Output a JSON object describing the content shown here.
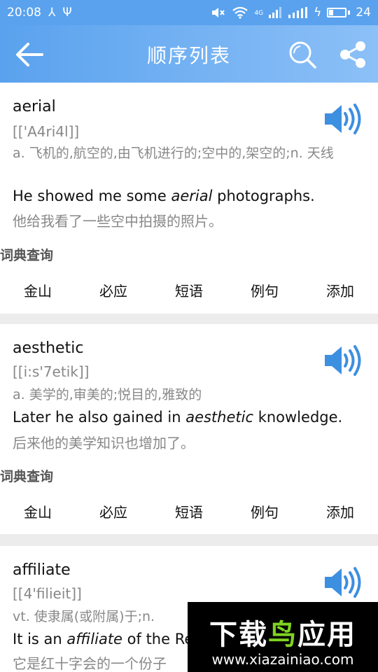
{
  "status": {
    "time": "20:08",
    "network_badge": "4G",
    "battery_level": "24",
    "battery_fraction": 0.24
  },
  "header": {
    "title": "顺序列表"
  },
  "dict_section_label": "词典查询",
  "dict_buttons": [
    "金山",
    "必应",
    "短语",
    "例句",
    "添加"
  ],
  "entries": [
    {
      "word": "aerial",
      "phonetic": "[['A4ri4l]]",
      "definition": "a. 飞机的,航空的,由飞机进行的;空中的,架空的;n. 天线",
      "example_before": "He showed me some ",
      "example_word": "aerial",
      "example_after": " photographs.",
      "translation": "他给我看了一些空中拍摄的照片。"
    },
    {
      "word": "aesthetic",
      "phonetic": "[[i:s'7etik]]",
      "definition": "a. 美学的,审美的;悦目的,雅致的",
      "example_before": "Later he also gained in ",
      "example_word": "aesthetic",
      "example_after": " knowledge.",
      "translation": "后来他的美学知识也增加了。"
    },
    {
      "word": "affiliate",
      "phonetic": "[[4'filieit]]",
      "definition": "vt. 使隶属(或附属)于;n.",
      "example_before": "It is an ",
      "example_word": "affiliate",
      "example_after": " of the Re",
      "translation": "它是红十字会的一个份子"
    }
  ],
  "watermark": {
    "title_part1": "下载",
    "title_part2": "鸟",
    "title_part3": "应用",
    "url": "www.xiazainiao.com"
  },
  "colors": {
    "accent": "#5aa2ee",
    "speaker": "#3d8fe0"
  }
}
